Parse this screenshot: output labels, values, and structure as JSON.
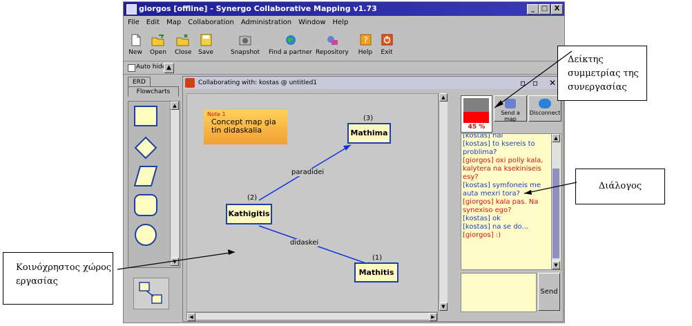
{
  "window": {
    "title": "giorgos [offline] - Synergo Collaborative Mapping v1.73",
    "btn_min": "_",
    "btn_max": "□",
    "btn_close": "X"
  },
  "menu": [
    "File",
    "Edit",
    "Map",
    "Collaboration",
    "Administration",
    "Window",
    "Help"
  ],
  "toolbar": [
    {
      "label": "New",
      "icon": "new-file-icon"
    },
    {
      "label": "Open",
      "icon": "open-folder-icon"
    },
    {
      "label": "Close",
      "icon": "close-folder-icon"
    },
    {
      "label": "Save",
      "icon": "save-icon"
    },
    {
      "label": "Snapshot",
      "icon": "camera-icon"
    },
    {
      "label": "Find a partner",
      "icon": "find-partner-icon"
    },
    {
      "label": "Repository",
      "icon": "repository-icon"
    },
    {
      "label": "Help",
      "icon": "help-icon"
    },
    {
      "label": "Exit",
      "icon": "power-icon"
    }
  ],
  "autohide": "Auto hide",
  "left_tabs": {
    "erd": "ERD",
    "flowcharts": "Flowcharts"
  },
  "collab": {
    "title": "Collaborating with: kostas @ untitled1",
    "note_label": "Note 1",
    "note_text": "Concept map gia tin didaskalia",
    "nodes": {
      "mathima": "Mathima",
      "kathigitis": "Kathigitis",
      "mathitis": "Mathitis"
    },
    "numbers": {
      "n3": "(3)",
      "n2": "(2)",
      "n1": "(1)"
    },
    "edges": {
      "paradidei": "paradidei",
      "didaskei": "didaskei"
    }
  },
  "symmetry": {
    "value": "45 %",
    "fill_fraction": 0.45
  },
  "buttons": {
    "send_map": "Send a map",
    "disconnect": "Disconnect",
    "send": "Send"
  },
  "chat": [
    {
      "text": "[kostas] nai",
      "speaker": "kostas"
    },
    {
      "text": "[kostas] to ksereis to",
      "speaker": "kostas"
    },
    {
      "text": "problima?",
      "speaker": "kostas"
    },
    {
      "text": "[giorgos] oxi polly kala,",
      "speaker": "giorgos"
    },
    {
      "text": "kalytera na ksekiniseis",
      "speaker": "giorgos"
    },
    {
      "text": "esy?",
      "speaker": "giorgos"
    },
    {
      "text": "[kostas] symfoneis me",
      "speaker": "kostas"
    },
    {
      "text": "auta mexri tora?",
      "speaker": "kostas"
    },
    {
      "text": "[giorgos] kala pas. Na",
      "speaker": "giorgos"
    },
    {
      "text": "synexiso ego?",
      "speaker": "giorgos"
    },
    {
      "text": "[kostas] ok",
      "speaker": "kostas"
    },
    {
      "text": "[kostas] na se do...",
      "speaker": "kostas"
    },
    {
      "text": "[giorgos] :)",
      "speaker": "giorgos"
    }
  ],
  "annotations": {
    "symmetry": "Δείκτης συμμετρίας της συνεργασίας",
    "dialogue": "Διάλογος",
    "workspace": "Κοινόχρηστος χώρος εργασίας"
  },
  "colors": {
    "title_bar": "#1f1f9a",
    "node_border": "#1a3fa5",
    "node_fill": "#fff8c0",
    "chat_bg": "#fffcc8",
    "kostas_text": "#1a3fc0",
    "giorgos_text": "#e01010",
    "edge": "#1030e0"
  }
}
